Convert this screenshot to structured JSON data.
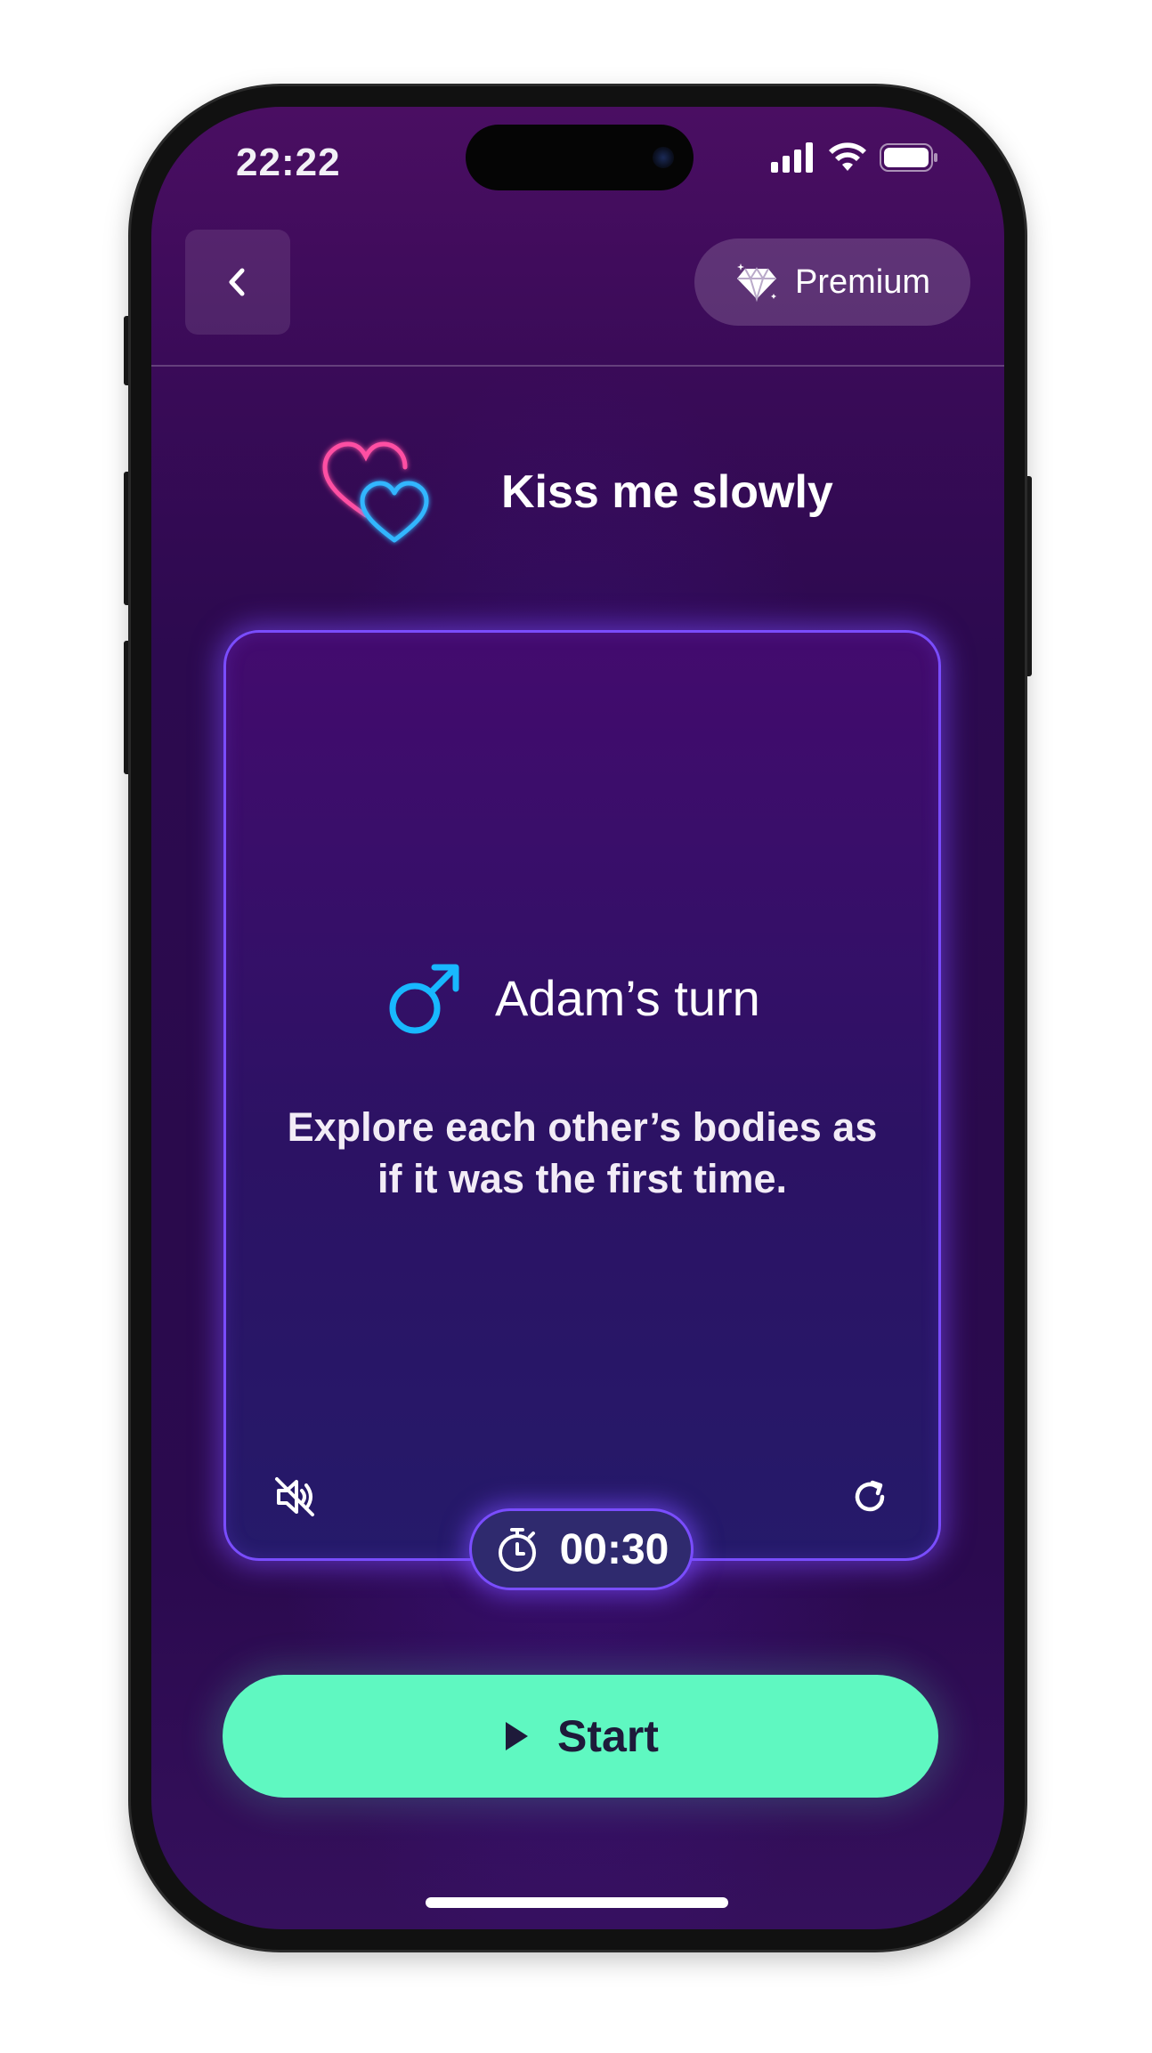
{
  "status_bar": {
    "time": "22:22"
  },
  "nav": {
    "back_icon": "chevron-left-icon",
    "premium_label": "Premium",
    "premium_icon": "diamond-icon"
  },
  "header": {
    "title": "Kiss me slowly",
    "icon": "hearts-icon"
  },
  "card": {
    "turn_label": "Adam’s turn",
    "turn_icon": "male-symbol-icon",
    "prompt": "Explore each other’s bodies as if it was the first time.",
    "mute_icon": "speaker-muted-icon",
    "reload_icon": "reload-icon"
  },
  "timer": {
    "value": "00:30",
    "icon": "stopwatch-icon"
  },
  "start_button": {
    "label": "Start",
    "icon": "play-icon"
  },
  "colors": {
    "accent_green": "#5ff8c1",
    "card_border": "#7a4dff",
    "heart_pink": "#ff4fa3",
    "heart_blue": "#33b6ff",
    "male_icon": "#18b8ff"
  }
}
